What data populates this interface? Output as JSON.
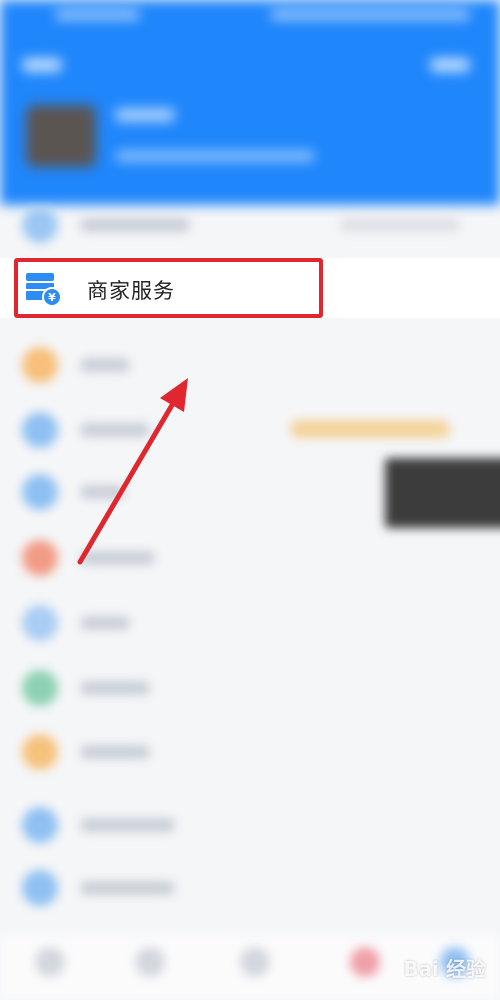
{
  "highlight": {
    "label": "商家服务",
    "icon": "merchant-store-icon"
  },
  "colors": {
    "header_bg": "#1f86fb",
    "annotation_red": "#e0262f",
    "icon_blue": "#2d8df5"
  },
  "blurred_rows": [
    {
      "icon_color": "#9cc7f3"
    },
    {
      "icon_color": "#f7bf7a"
    },
    {
      "icon_color": "#8fc0f2"
    },
    {
      "icon_color": "#8fc0f2"
    },
    {
      "icon_color": "#f19b84"
    },
    {
      "icon_color": "#a9cdf4"
    },
    {
      "icon_color": "#8cd1b2"
    },
    {
      "icon_color": "#f7c27c"
    },
    {
      "icon_color": "#8fc0f2"
    },
    {
      "icon_color": "#8fc0f2"
    }
  ],
  "watermark": "Bai 经验"
}
